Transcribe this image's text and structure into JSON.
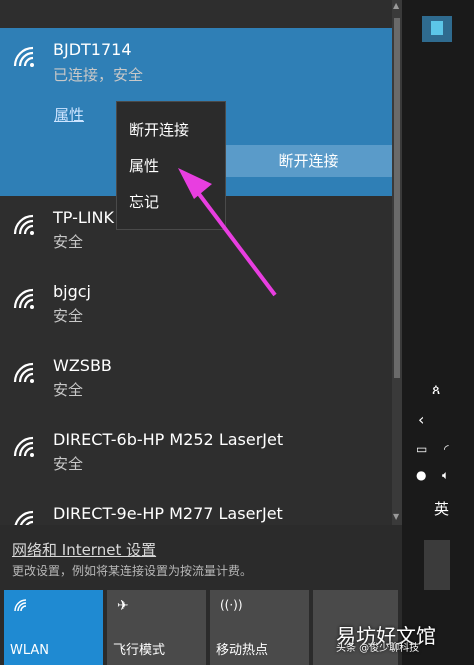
{
  "networks": [
    {
      "name": "BJDT1714",
      "status": "已连接，安全"
    },
    {
      "name": "TP-LINK",
      "status": "安全"
    },
    {
      "name": "bjgcj",
      "status": "安全"
    },
    {
      "name": "WZSBB",
      "status": "安全"
    },
    {
      "name": "DIRECT-6b-HP M252 LaserJet",
      "status": "安全"
    },
    {
      "name": "DIRECT-9e-HP M277 LaserJet",
      "status": ""
    }
  ],
  "active": {
    "properties_link": "属性",
    "disconnect_button": "断开连接"
  },
  "context_menu": {
    "items": [
      "断开连接",
      "属性",
      "忘记"
    ]
  },
  "settings": {
    "link": "网络和 Internet 设置",
    "description": "更改设置，例如将某连接设置为按流量计费。"
  },
  "quick_actions": [
    {
      "label": "WLAN",
      "icon": "wifi-icon"
    },
    {
      "label": "飞行模式",
      "icon": "airplane-icon"
    },
    {
      "label": "移动热点",
      "icon": "hotspot-icon"
    }
  ],
  "tray": {
    "ime": "英"
  },
  "watermark": {
    "main": "易坊好文馆",
    "sub": "头条 @俊少聊科技"
  },
  "colors": {
    "accent": "#2f7fb6",
    "button": "#5a9bc9",
    "arrow": "#e83ee0",
    "tile_active": "#1f8ad2",
    "tile_inactive": "#4a4a4a"
  }
}
